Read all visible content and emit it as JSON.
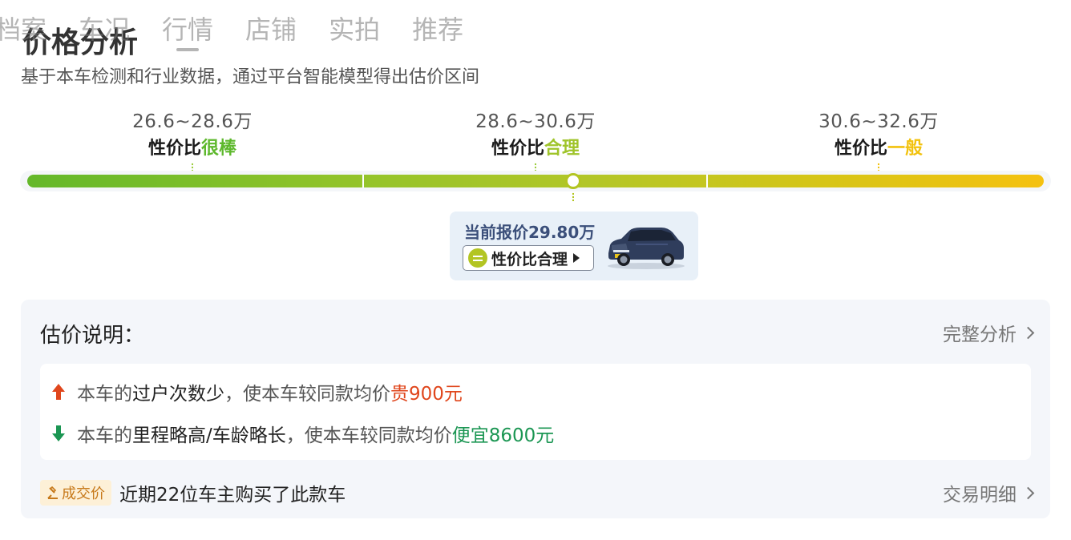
{
  "tabs": [
    "档案",
    "车况",
    "行情",
    "店铺",
    "实拍",
    "推荐"
  ],
  "active_tab": "行情",
  "title": "价格分析",
  "subtitle": "基于本车检测和行业数据，通过平台智能模型得出估价区间",
  "ranges": [
    {
      "value": "26.6~28.6万",
      "label_prefix": "性价比",
      "label_rating": "很棒",
      "color": "#5db82c"
    },
    {
      "value": "28.6~30.6万",
      "label_prefix": "性价比",
      "label_rating": "合理",
      "color": "#9fc42a"
    },
    {
      "value": "30.6~32.6万",
      "label_prefix": "性价比",
      "label_rating": "一般",
      "color": "#f2c20e"
    }
  ],
  "current_price": {
    "text": "当前报价29.80万",
    "value_wan": 29.8,
    "badge_label": "性价比合理"
  },
  "explanation": {
    "title": "估价说明：",
    "link": "完整分析",
    "items": [
      {
        "direction": "up",
        "prefix": "本车的",
        "factor": "过户次数少",
        "middle": "，使本车较同款均价",
        "effect": "贵900元"
      },
      {
        "direction": "down",
        "prefix": "本车的",
        "factor": "里程略高/车龄略长",
        "middle": "，使本车较同款均价",
        "effect": "便宜8600元"
      }
    ],
    "deal_badge": "成交价",
    "deal_text": "近期22位车主购买了此款车",
    "deal_link": "交易明细"
  },
  "colors": {
    "up": "#e0461c",
    "down": "#1b9653",
    "marker": "#b3c522"
  }
}
